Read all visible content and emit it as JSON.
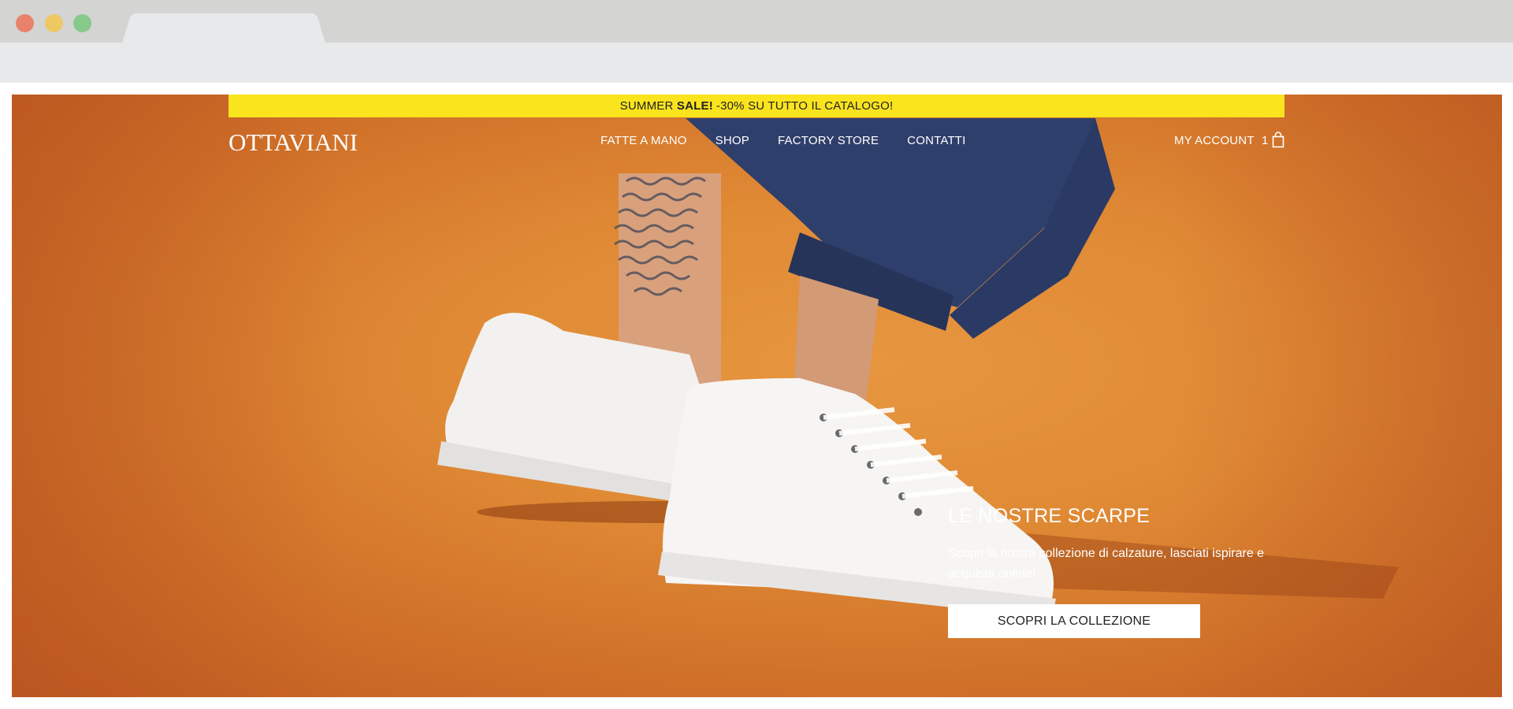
{
  "browser": {
    "window_controls": [
      "close",
      "minimize",
      "maximize"
    ]
  },
  "promo": {
    "prefix": "SUMMER",
    "highlight": "SALE!",
    "text": "-30% SU TUTTO IL CATALOGO!"
  },
  "header": {
    "logo": "OTTAVIANI",
    "nav": [
      "FATTE A MANO",
      "SHOP",
      "FACTORY STORE",
      "CONTATTI"
    ],
    "account_label": "MY ACCOUNT",
    "cart_count": "1",
    "cart_icon": "shopping-bag-icon"
  },
  "hero": {
    "title": "LE NOSTRE SCARPE",
    "description": "Scopri la nostra collezione di calzature, lasciati ispirare e acquista online!",
    "cta_label": "SCOPRI LA COLLEZIONE",
    "image_subject": "white leather sneakers with rolled navy trousers on orange background"
  },
  "colors": {
    "promo_bg": "#fae41e",
    "hero_bg": "#e08a35",
    "cta_bg": "#ffffff"
  }
}
